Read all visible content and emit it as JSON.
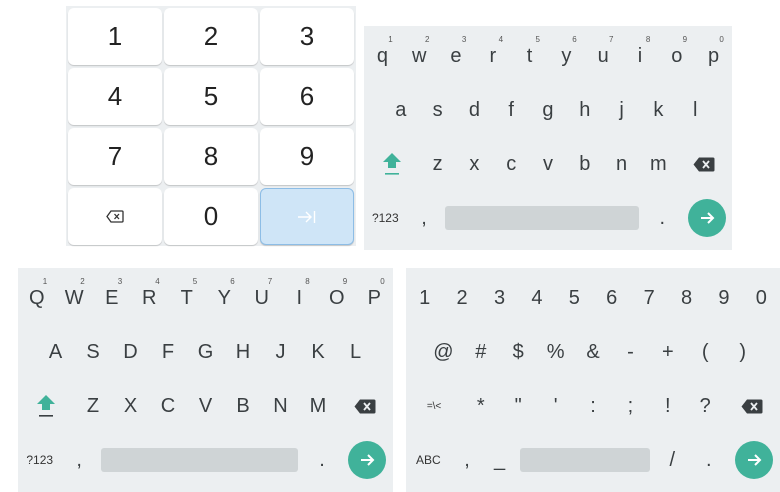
{
  "colors": {
    "keyboard_bg": "#eceff1",
    "key_bg": "#ffffff",
    "enter_accent": "#40b29a",
    "shift_accent": "#40b29a",
    "spacebar": "#cfd4d6",
    "numpad_enter_bg": "#cfe5f7"
  },
  "icons": {
    "backspace": "backspace-icon",
    "shift": "shift-arrow-icon",
    "enter": "arrow-right-icon",
    "next_field": "tab-right-icon"
  },
  "numpad": {
    "keys": [
      "1",
      "2",
      "3",
      "4",
      "5",
      "6",
      "7",
      "8",
      "9",
      "0"
    ]
  },
  "lowercase": {
    "row1": [
      "q",
      "w",
      "e",
      "r",
      "t",
      "y",
      "u",
      "i",
      "o",
      "p"
    ],
    "row1_hints": [
      "1",
      "2",
      "3",
      "4",
      "5",
      "6",
      "7",
      "8",
      "9",
      "0"
    ],
    "row2": [
      "a",
      "s",
      "d",
      "f",
      "g",
      "h",
      "j",
      "k",
      "l"
    ],
    "row3": [
      "z",
      "x",
      "c",
      "v",
      "b",
      "n",
      "m"
    ],
    "symbols_label": "?123",
    "comma": ",",
    "period": "."
  },
  "uppercase": {
    "row1": [
      "Q",
      "W",
      "E",
      "R",
      "T",
      "Y",
      "U",
      "I",
      "O",
      "P"
    ],
    "row1_hints": [
      "1",
      "2",
      "3",
      "4",
      "5",
      "6",
      "7",
      "8",
      "9",
      "0"
    ],
    "row2": [
      "A",
      "S",
      "D",
      "F",
      "G",
      "H",
      "J",
      "K",
      "L"
    ],
    "row3": [
      "Z",
      "X",
      "C",
      "V",
      "B",
      "N",
      "M"
    ],
    "symbols_label": "?123",
    "comma": ",",
    "period": "."
  },
  "symbols": {
    "row1": [
      "1",
      "2",
      "3",
      "4",
      "5",
      "6",
      "7",
      "8",
      "9",
      "0"
    ],
    "row2": [
      "@",
      "#",
      "$",
      "%",
      "&",
      "-",
      "+",
      "(",
      ")"
    ],
    "more_symbols_label": "=\\<",
    "row3": [
      "*",
      "\"",
      "'",
      ":",
      ";",
      "!",
      "?"
    ],
    "abc_label": "ABC",
    "comma": ",",
    "underscore": "_",
    "slash": "/",
    "period": "."
  }
}
